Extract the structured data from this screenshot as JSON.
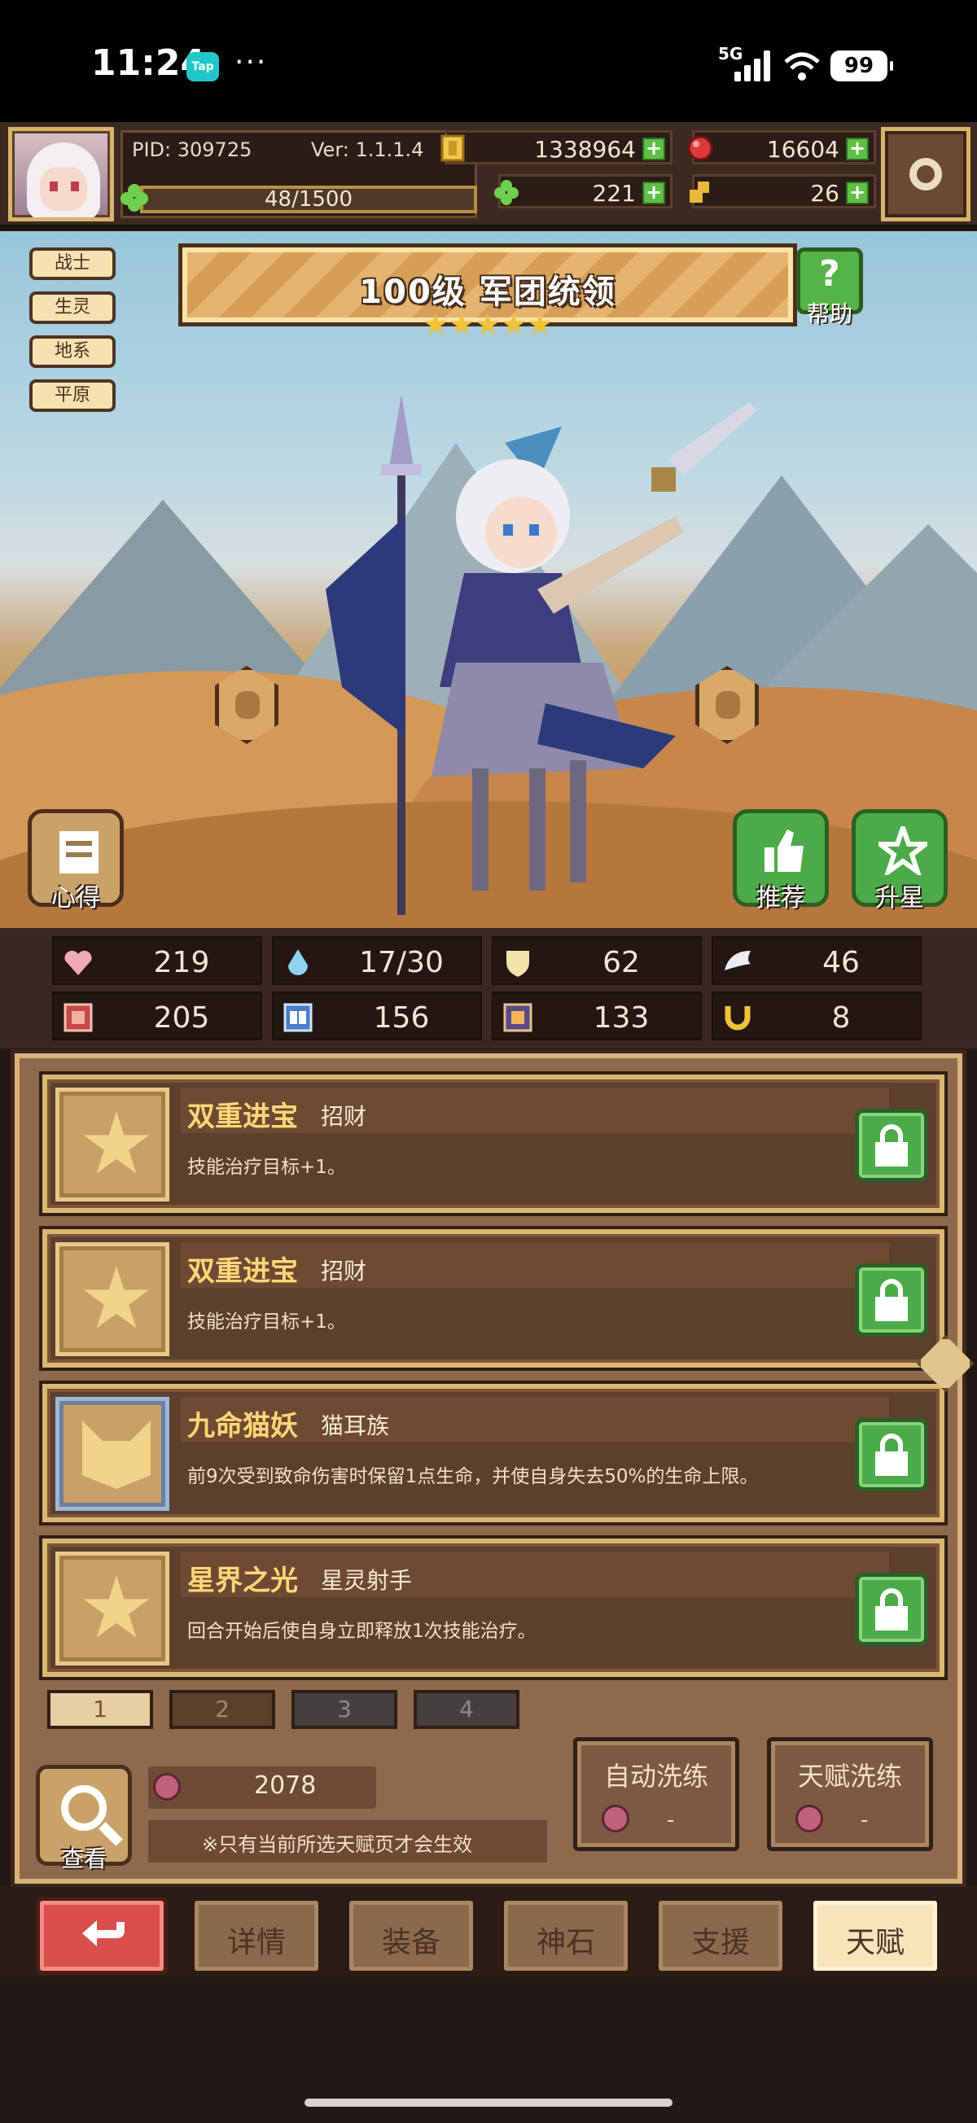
{
  "status_bar": {
    "time": "11:24",
    "tap_badge": "Tap",
    "dots": "···",
    "network": "5G",
    "battery": "99"
  },
  "header": {
    "pid": "PID: 309725",
    "version": "Ver: 1.1.1.4",
    "xp": "48/1500",
    "gold": "1338964",
    "gems": "16604",
    "clover": "221",
    "keys": "26"
  },
  "hero": {
    "tags": [
      "战士",
      "生灵",
      "地系",
      "平原"
    ],
    "title": "100级  军团统领",
    "stars": 5,
    "help_label": "帮助",
    "xinde_label": "心得",
    "recommend_label": "推荐",
    "upstar_label": "升星"
  },
  "stats": [
    {
      "icon": "heart-icon",
      "value": "219"
    },
    {
      "icon": "mana-drop-icon",
      "value": "17/30"
    },
    {
      "icon": "shield-icon",
      "value": "62"
    },
    {
      "icon": "wing-icon",
      "value": "46"
    },
    {
      "icon": "fist-icon",
      "value": "205"
    },
    {
      "icon": "book-icon",
      "value": "156"
    },
    {
      "icon": "armor-icon",
      "value": "133"
    },
    {
      "icon": "horseshoe-icon",
      "value": "8"
    }
  ],
  "talents": [
    {
      "name": "双重进宝",
      "type": "招财",
      "desc": "技能治疗目标+1。",
      "icon": "star-icon"
    },
    {
      "name": "双重进宝",
      "type": "招财",
      "desc": "技能治疗目标+1。",
      "icon": "star-icon"
    },
    {
      "name": "九命猫妖",
      "type": "猫耳族",
      "desc": "前9次受到致命伤害时保留1点生命，并使自身失去50%的生命上限。",
      "icon": "cat-icon"
    },
    {
      "name": "星界之光",
      "type": "星灵射手",
      "desc": "回合开始后使自身立即释放1次技能治疗。",
      "icon": "star-icon"
    }
  ],
  "pages": [
    "1",
    "2",
    "3",
    "4"
  ],
  "bottom": {
    "view_label": "查看",
    "resource_value": "2078",
    "note": "※只有当前所选天赋页才会生效",
    "auto_wash_label": "自动洗练",
    "auto_wash_value": "-",
    "talent_wash_label": "天赋洗练",
    "talent_wash_value": "-"
  },
  "nav": {
    "details": "详情",
    "equipment": "装备",
    "godstone": "神石",
    "support": "支援",
    "talent": "天赋"
  },
  "colors": {
    "accent_gold": "#d9b872",
    "lock_green": "#4cab48",
    "back_red": "#d94d4a"
  }
}
